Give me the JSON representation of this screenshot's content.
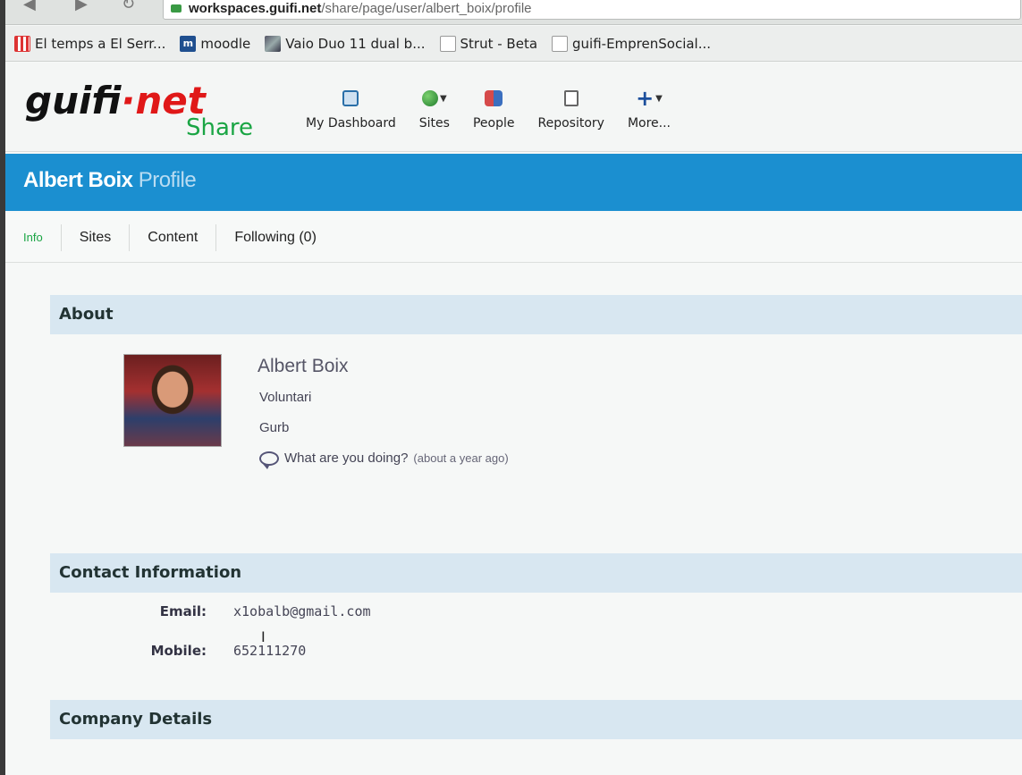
{
  "browser": {
    "url_host": "workspaces.guifi.net",
    "url_path": "/share/page/user/albert_boix/profile",
    "bookmarks": [
      {
        "label": "El temps a El Serr...",
        "icon": "weather-icon"
      },
      {
        "label": "moodle",
        "icon": "moodle-icon"
      },
      {
        "label": "Vaio Duo 11 dual b...",
        "icon": "image-thumb-icon"
      },
      {
        "label": "Strut - Beta",
        "icon": "document-icon"
      },
      {
        "label": "guifi-EmprenSocial...",
        "icon": "document-icon"
      }
    ]
  },
  "header": {
    "logo_main": "guifi",
    "logo_dot": "·",
    "logo_net": "net",
    "logo_share": "Share",
    "nav": [
      {
        "label": "My Dashboard",
        "icon": "dashboard-icon"
      },
      {
        "label": "Sites",
        "icon": "globe-icon"
      },
      {
        "label": "People",
        "icon": "people-icon"
      },
      {
        "label": "Repository",
        "icon": "repository-icon"
      },
      {
        "label": "More...",
        "icon": "plus-icon"
      }
    ]
  },
  "title": {
    "name": "Albert Boix",
    "suffix": "Profile"
  },
  "tabs": [
    "Info",
    "Sites",
    "Content",
    "Following (0)"
  ],
  "about": {
    "heading": "About",
    "name": "Albert Boix",
    "role": "Voluntari",
    "location": "Gurb",
    "status": "What are you doing?",
    "status_time": "(about a year ago)"
  },
  "contact": {
    "heading": "Contact Information",
    "email_label": "Email:",
    "email": "x1obalb@gmail.com",
    "mobile_label": "Mobile:",
    "mobile": "652111270"
  },
  "company": {
    "heading": "Company Details"
  },
  "colors": {
    "titlebar": "#1b8fd0",
    "section": "#d8e7f1",
    "logo_red": "#e01818",
    "logo_green": "#1aa544"
  }
}
